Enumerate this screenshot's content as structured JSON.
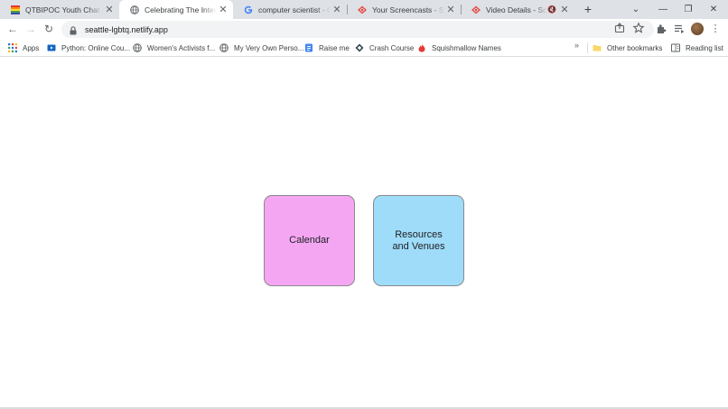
{
  "browser": {
    "tabs": [
      {
        "title": "QTBIPOC Youth Chat | Eve",
        "favicon": "rainbow-flag-icon",
        "active": false
      },
      {
        "title": "Celebrating The Intersectio",
        "favicon": "globe-icon",
        "active": true
      },
      {
        "title": "computer scientist - Goog",
        "favicon": "google-icon",
        "active": false
      },
      {
        "title": "Your Screencasts - Screen",
        "favicon": "screencastify-icon",
        "active": false
      },
      {
        "title": "Video Details - Screen",
        "favicon": "screencastify-icon",
        "active": false,
        "muted": true
      }
    ],
    "url": "seattle-lgbtq.netlify.app"
  },
  "bookmarks": {
    "items": [
      {
        "label": "Apps",
        "icon": "apps-grid-icon"
      },
      {
        "label": "Python: Online Cou...",
        "icon": "video-icon"
      },
      {
        "label": "Women's Activists f...",
        "icon": "globe-icon"
      },
      {
        "label": "My Very Own Perso...",
        "icon": "globe-icon"
      },
      {
        "label": "Raise me",
        "icon": "doc-icon"
      },
      {
        "label": "Crash Course",
        "icon": "crash-course-icon"
      },
      {
        "label": "Squishmallow Names",
        "icon": "fire-icon"
      }
    ],
    "overflow": "»",
    "other": "Other bookmarks",
    "reading_list": "Reading list"
  },
  "page": {
    "cards": [
      {
        "label": "Calendar",
        "color": "#f4a6f3"
      },
      {
        "label_line1": "Resources",
        "label_line2": "and Venues",
        "color": "#9fdcfa"
      }
    ]
  }
}
